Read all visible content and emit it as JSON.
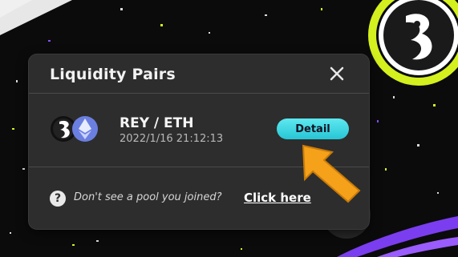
{
  "modal": {
    "title": "Liquidity Pairs",
    "close_icon": "close-icon"
  },
  "pair": {
    "name": "REY / ETH",
    "date": "2022/1/16 21:12:13",
    "detail_label": "Detail",
    "icons": [
      "rey-token-icon",
      "eth-token-icon"
    ]
  },
  "help": {
    "icon": "question-circle-icon",
    "text": "Don't see a pool you joined?",
    "link_label": "Click here"
  },
  "colors": {
    "modal_bg": "#2d2d2d",
    "accent_cyan": "#26c6d6",
    "arrow_orange": "#f5a11a",
    "lime": "#d4f01e",
    "purple": "#7b3df0"
  }
}
